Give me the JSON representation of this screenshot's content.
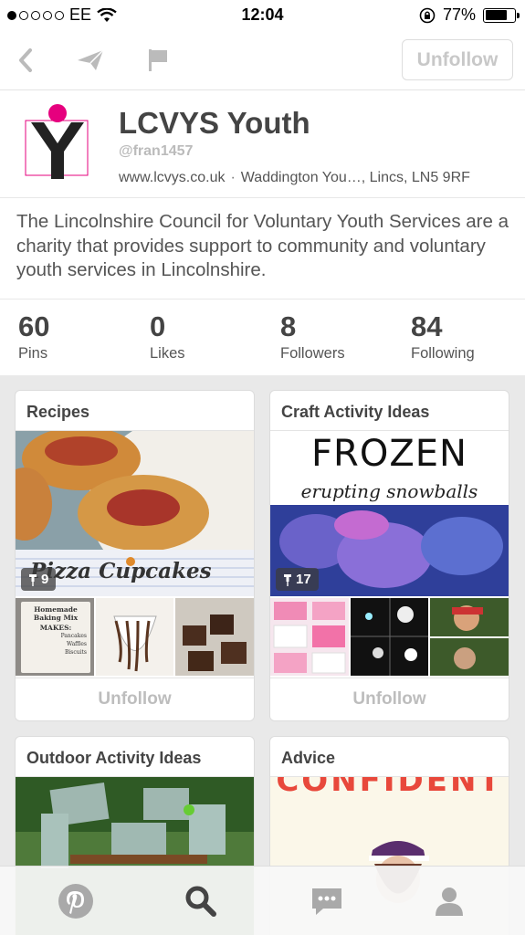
{
  "status_bar": {
    "carrier": "EE",
    "time": "12:04",
    "battery": "77%",
    "battery_level": 0.77
  },
  "nav": {
    "back_icon": "chevron-left-icon",
    "send_icon": "paper-plane-icon",
    "report_icon": "flag-icon",
    "unfollow_label": "Unfollow"
  },
  "profile": {
    "name": "LCVYS Youth",
    "handle": "@fran1457",
    "website": "www.lcvys.co.uk",
    "location": "Waddington You…, Lincs, LN5 9RF",
    "about": "The Lincolnshire Council for Voluntary Youth Services are a charity that provides support to community and voluntary youth services in Lincolnshire."
  },
  "stats": [
    {
      "value": "60",
      "label": "Pins"
    },
    {
      "value": "0",
      "label": "Likes"
    },
    {
      "value": "8",
      "label": "Followers"
    },
    {
      "value": "84",
      "label": "Following"
    }
  ],
  "boards": [
    {
      "title": "Recipes",
      "pin_count": "9",
      "cover_text": "Pizza Cupcakes",
      "thumb_text": [
        "Homemade",
        "Baking Mix",
        "MAKES:",
        "Pancakes",
        "Waffles",
        "Biscuits"
      ],
      "button": "Unfollow"
    },
    {
      "title": "Craft Activity Ideas",
      "pin_count": "17",
      "cover_text": "FROZEN",
      "cover_subtext": "erupting snowballs",
      "button": "Unfollow"
    },
    {
      "title": "Outdoor Activity Ideas"
    },
    {
      "title": "Advice",
      "cover_text": "CONFIDENT"
    }
  ],
  "tabs": [
    {
      "name": "home",
      "icon": "pinterest-logo-icon"
    },
    {
      "name": "search",
      "icon": "search-icon"
    },
    {
      "name": "messages",
      "icon": "chat-bubble-icon"
    },
    {
      "name": "profile",
      "icon": "user-icon"
    }
  ],
  "colors": {
    "brand_red": "#cb2027",
    "accent_pink": "#e6007e",
    "muted_text": "#bdbdbd"
  }
}
